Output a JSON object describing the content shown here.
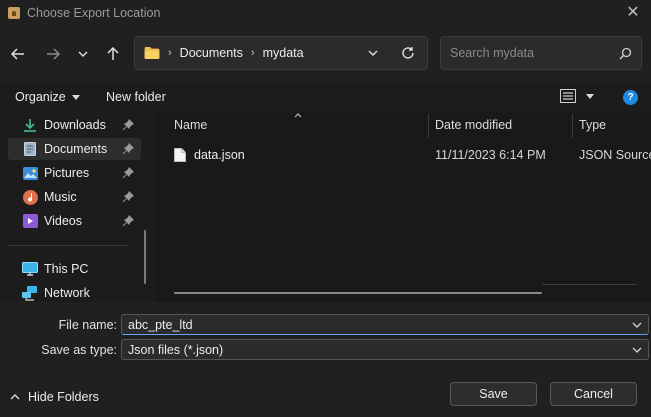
{
  "window": {
    "title": "Choose Export Location",
    "close_glyph": "✕"
  },
  "nav": {
    "back_icon": "arrow-left-icon",
    "forward_icon": "arrow-right-icon",
    "recent_icon": "chevron-down-icon",
    "up_icon": "arrow-up-icon"
  },
  "address": {
    "crumbs": [
      "Documents",
      "mydata"
    ],
    "separator": "›"
  },
  "search": {
    "placeholder": "Search mydata"
  },
  "command_bar": {
    "organize_label": "Organize",
    "new_folder_label": "New folder"
  },
  "sidebar": {
    "items": [
      {
        "label": "Downloads",
        "icon": "download-icon",
        "pinned": true
      },
      {
        "label": "Documents",
        "icon": "document-icon",
        "pinned": true,
        "selected": true
      },
      {
        "label": "Pictures",
        "icon": "picture-icon",
        "pinned": true
      },
      {
        "label": "Music",
        "icon": "music-icon",
        "pinned": true
      },
      {
        "label": "Videos",
        "icon": "video-icon",
        "pinned": true
      },
      {
        "label": "This PC",
        "icon": "computer-icon",
        "pinned": false
      },
      {
        "label": "Network",
        "icon": "network-icon",
        "pinned": false
      }
    ]
  },
  "file_list": {
    "columns": [
      "Name",
      "Date modified",
      "Type"
    ],
    "rows": [
      {
        "name": "data.json",
        "date_modified": "11/11/2023 6:14 PM",
        "type": "JSON Source File"
      }
    ]
  },
  "form": {
    "file_name_label": "File name:",
    "file_name_value": "abc_pte_ltd",
    "save_type_label": "Save as type:",
    "save_type_value": "Json files (*.json)"
  },
  "footer": {
    "hide_folders_label": "Hide Folders",
    "save_label": "Save",
    "cancel_label": "Cancel"
  },
  "colors": {
    "accent": "#1e88e5",
    "folder": "#f2c14e",
    "background": "#1c1c1c"
  }
}
